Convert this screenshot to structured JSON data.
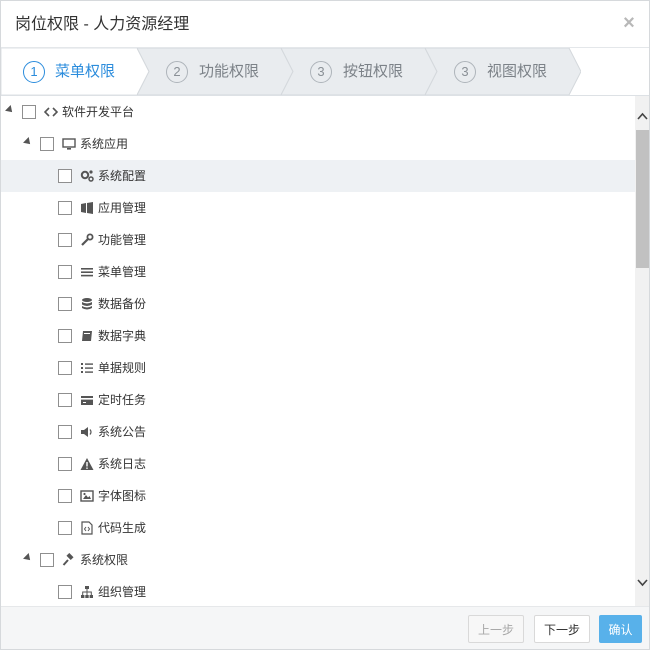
{
  "dialog": {
    "title": "岗位权限 - 人力资源经理",
    "close_symbol": "×"
  },
  "steps": [
    {
      "number": "1",
      "label": "菜单权限",
      "active": true
    },
    {
      "number": "2",
      "label": "功能权限",
      "active": false
    },
    {
      "number": "3",
      "label": "按钮权限",
      "active": false
    },
    {
      "number": "3",
      "label": "视图权限",
      "active": false
    }
  ],
  "tree": [
    {
      "label": "软件开发平台",
      "icon": "code-icon",
      "level": 0,
      "expanded": true
    },
    {
      "label": "系统应用",
      "icon": "monitor-icon",
      "level": 1,
      "expanded": true
    },
    {
      "label": "系统配置",
      "icon": "cogs-icon",
      "level": 2,
      "highlighted": true
    },
    {
      "label": "应用管理",
      "icon": "windows-icon",
      "level": 2
    },
    {
      "label": "功能管理",
      "icon": "wrench-icon",
      "level": 2
    },
    {
      "label": "菜单管理",
      "icon": "bars-icon",
      "level": 2
    },
    {
      "label": "数据备份",
      "icon": "database-icon",
      "level": 2
    },
    {
      "label": "数据字典",
      "icon": "book-icon",
      "level": 2
    },
    {
      "label": "单据规则",
      "icon": "list-ol-icon",
      "level": 2
    },
    {
      "label": "定时任务",
      "icon": "credit-card-icon",
      "level": 2
    },
    {
      "label": "系统公告",
      "icon": "volume-icon",
      "level": 2
    },
    {
      "label": "系统日志",
      "icon": "warning-icon",
      "level": 2
    },
    {
      "label": "字体图标",
      "icon": "image-icon",
      "level": 2
    },
    {
      "label": "代码生成",
      "icon": "file-code-icon",
      "level": 2
    },
    {
      "label": "系统权限",
      "icon": "gavel-icon",
      "level": 1,
      "expanded": true
    },
    {
      "label": "组织管理",
      "icon": "sitemap-icon",
      "level": 2
    }
  ],
  "footer": {
    "prev_label": "上一步",
    "next_label": "下一步",
    "confirm_label": "确认"
  },
  "colors": {
    "accent": "#2b8cdc",
    "confirm_bg": "#58b1ea",
    "row_highlight": "#eef1f4"
  }
}
